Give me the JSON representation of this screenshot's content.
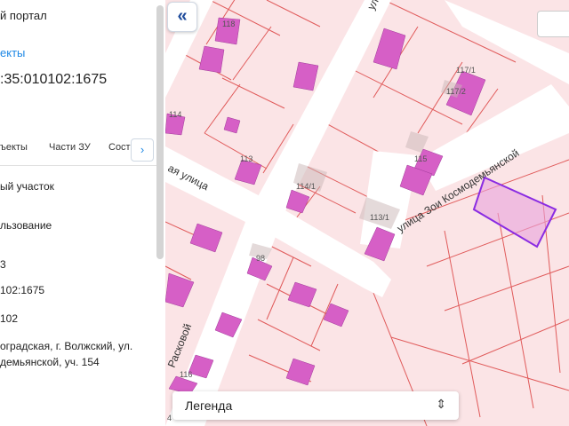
{
  "panel": {
    "portal_title": "й портал",
    "objects_link": "екты",
    "cadastral_number": ":35:010102:1675",
    "tabs": [
      "ъекты",
      "Части ЗУ",
      "Соста"
    ],
    "tab_next_icon": "chevron-right-icon",
    "fields": [
      "ый участок",
      "льзование",
      "3",
      "102:1675",
      "102",
      "оградская, г. Волжский, ул.",
      "демьянской, уч. 154"
    ]
  },
  "map": {
    "collapse_icon": "double-chevron-left-icon",
    "legend_label": "Легенда",
    "legend_icon": "chevron-up-down-icon",
    "parcel_labels": [
      "118",
      "117/1",
      "117/2",
      "114",
      "113",
      "115",
      "114/1",
      "113/1",
      "98",
      "116",
      "4"
    ],
    "street_labels": [
      "улица Зои Космодемьянской",
      "ая  улица",
      "Расковой",
      "ул"
    ],
    "colors": {
      "parcel_fill": "#fbe4e6",
      "parcel_border": "#e05a5a",
      "building_fill": "#d65fc6",
      "highlight_border": "#8a2be2",
      "road": "#ffffff"
    }
  }
}
